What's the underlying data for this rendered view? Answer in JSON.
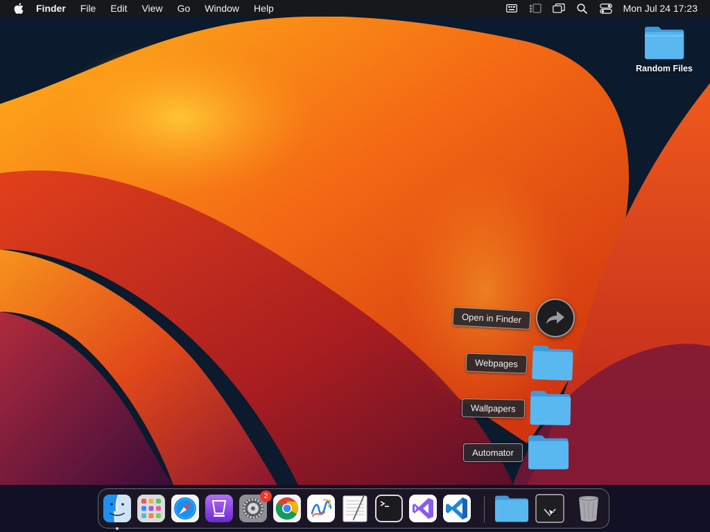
{
  "menubar": {
    "apple_icon": "apple-logo-icon",
    "app_name": "Finder",
    "menus": [
      "File",
      "Edit",
      "View",
      "Go",
      "Window",
      "Help"
    ],
    "status_icons": [
      "keyboard-viewer-icon",
      "stage-manager-icon",
      "screen-mirroring-icon",
      "spotlight-search-icon",
      "control-center-icon"
    ],
    "clock": "Mon Jul 24  17:23"
  },
  "desktop": {
    "items": [
      {
        "label": "Random Files",
        "icon": "folder-icon",
        "color": "#5ab8f0"
      }
    ]
  },
  "stack": {
    "open_label": "Open in Finder",
    "open_icon": "arrow-forward-icon",
    "items": [
      {
        "label": "Webpages",
        "icon": "folder-icon"
      },
      {
        "label": "Wallpapers",
        "icon": "folder-icon"
      },
      {
        "label": "Automator",
        "icon": "folder-icon"
      }
    ]
  },
  "dock": {
    "apps": [
      {
        "name": "Finder",
        "icon": "finder-icon",
        "running": true
      },
      {
        "name": "Launchpad",
        "icon": "launchpad-icon"
      },
      {
        "name": "Safari",
        "icon": "safari-icon"
      },
      {
        "name": "Podcasts",
        "icon": "podcasts-icon"
      },
      {
        "name": "System Settings",
        "icon": "system-settings-icon",
        "badge": "2"
      },
      {
        "name": "Google Chrome",
        "icon": "chrome-icon"
      },
      {
        "name": "Freeform",
        "icon": "freeform-icon"
      },
      {
        "name": "TextEdit",
        "icon": "textedit-icon"
      },
      {
        "name": "Terminal",
        "icon": "terminal-icon"
      },
      {
        "name": "Visual Studio",
        "icon": "visual-studio-icon"
      },
      {
        "name": "Visual Studio Code",
        "icon": "vscode-icon"
      }
    ],
    "right_items": [
      {
        "name": "Downloads stack",
        "icon": "folder-stack-icon"
      },
      {
        "name": "Downloads",
        "icon": "download-icon"
      },
      {
        "name": "Trash",
        "icon": "trash-icon"
      }
    ],
    "colors": {
      "accent_red": "#e8392f",
      "folder_blue": "#5ab8f0"
    }
  }
}
